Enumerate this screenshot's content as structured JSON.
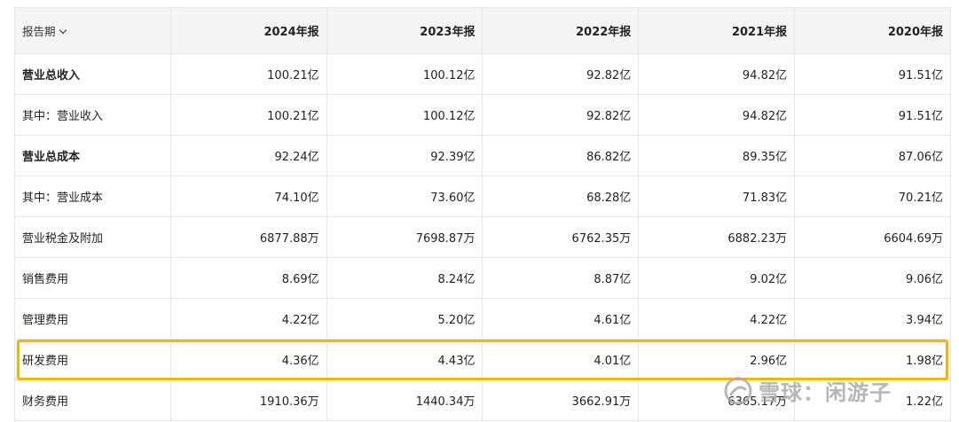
{
  "table": {
    "period_selector": "报告期",
    "columns": [
      "2024年报",
      "2023年报",
      "2022年报",
      "2021年报",
      "2020年报"
    ],
    "rows": [
      {
        "label": "营业总收入",
        "values": [
          "100.21亿",
          "100.12亿",
          "92.82亿",
          "94.82亿",
          "91.51亿"
        ]
      },
      {
        "label": "其中：营业收入",
        "values": [
          "100.21亿",
          "100.12亿",
          "92.82亿",
          "94.82亿",
          "91.51亿"
        ]
      },
      {
        "label": "营业总成本",
        "values": [
          "92.24亿",
          "92.39亿",
          "86.82亿",
          "89.35亿",
          "87.06亿"
        ]
      },
      {
        "label": "其中：营业成本",
        "values": [
          "74.10亿",
          "73.60亿",
          "68.28亿",
          "71.83亿",
          "70.21亿"
        ]
      },
      {
        "label": "营业税金及附加",
        "values": [
          "6877.88万",
          "7698.87万",
          "6762.35万",
          "6882.23万",
          "6604.69万"
        ]
      },
      {
        "label": "销售费用",
        "values": [
          "8.69亿",
          "8.24亿",
          "8.87亿",
          "9.02亿",
          "9.06亿"
        ]
      },
      {
        "label": "管理费用",
        "values": [
          "4.22亿",
          "5.20亿",
          "4.61亿",
          "4.22亿",
          "3.94亿"
        ]
      },
      {
        "label": "研发费用",
        "values": [
          "4.36亿",
          "4.43亿",
          "4.01亿",
          "2.96亿",
          "1.98亿"
        ]
      },
      {
        "label": "财务费用",
        "values": [
          "1910.36万",
          "1440.34万",
          "3662.91万",
          "6365.17万",
          "1.22亿"
        ]
      }
    ]
  },
  "highlight": {
    "row": "研发费用",
    "color": "#f2b800"
  },
  "watermark": {
    "text": "雪球：闲游子",
    "icon": "snowball-logo-icon"
  },
  "colors": {
    "header_bg": "#f5f5f5",
    "border": "#e6e6e6",
    "text": "#222222"
  }
}
